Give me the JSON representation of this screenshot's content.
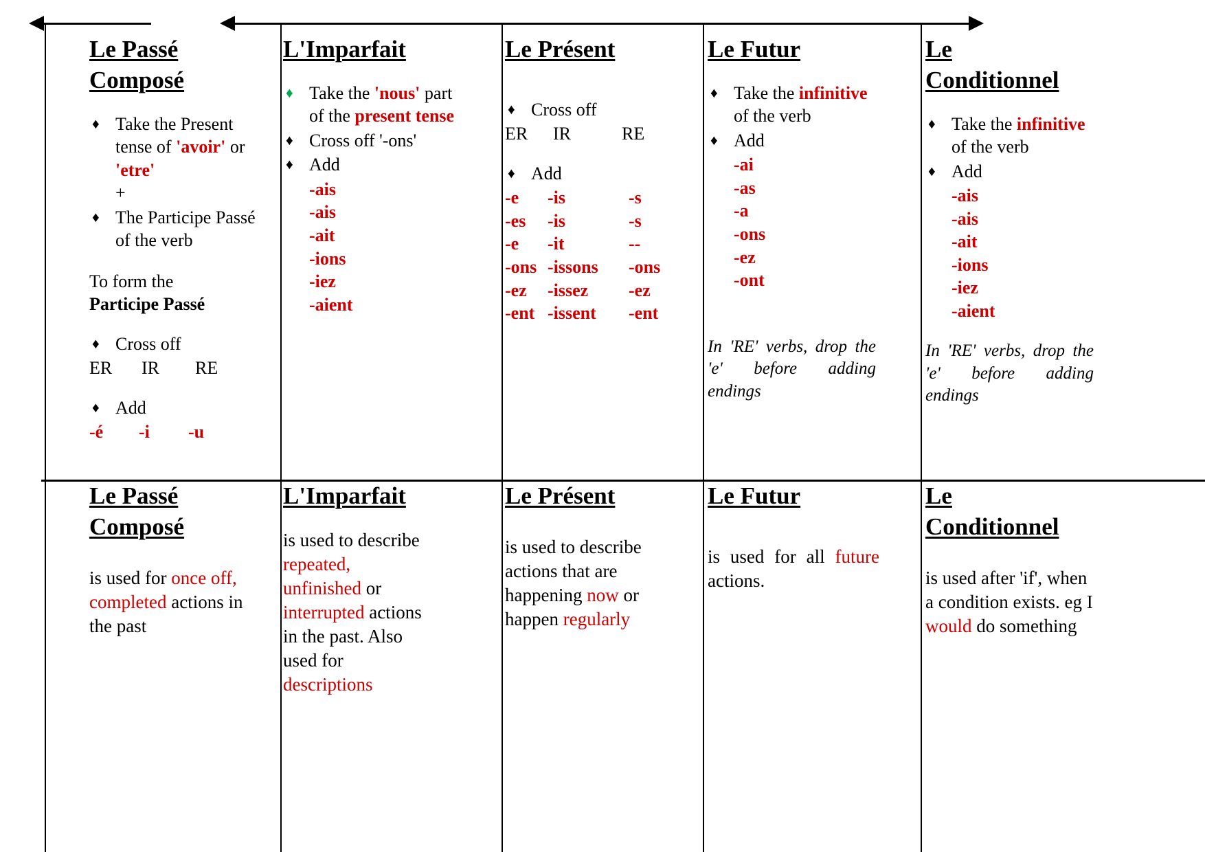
{
  "document": {
    "title": "French Verb Tenses Reference Chart",
    "accent_red": "#cc0000",
    "accent_green": "#00a651"
  },
  "bullet_glyph": "♦",
  "formation": {
    "passe_compose": {
      "title_line1": "Le Passé",
      "title_line2": "Composé",
      "bullet1": "Take the Present tense of ",
      "bullet1_red1": "'avoir'",
      "bullet1_mid": " or ",
      "bullet1_red2": "'etre'",
      "plus": "+",
      "bullet2": "The Participe Passé of the verb",
      "subhead_line1": "To form the",
      "subhead_line2": "Participe Passé",
      "bullet3": "Cross off",
      "stems": [
        "ER",
        "IR",
        "RE"
      ],
      "bullet4": "Add",
      "endings": [
        "-é",
        "-i",
        "-u"
      ]
    },
    "imparfait": {
      "title_line1": "L'Imparfait",
      "bullet1_pre": "Take the ",
      "bullet1_red1": "'nous'",
      "bullet1_mid": " part of the ",
      "bullet1_red2": "present tense",
      "bullet2": "Cross off '-ons'",
      "bullet3": "Add",
      "endings": [
        "-ais",
        "-ais",
        "-ait",
        "-ions",
        "-iez",
        "-aient"
      ]
    },
    "present": {
      "title_line1": "Le Présent",
      "bullet1": "Cross off",
      "stems": [
        "ER",
        "IR",
        "RE"
      ],
      "bullet2": "Add",
      "endings_er": [
        "-e",
        "-es",
        "-e",
        "-ons",
        "-ez",
        "-ent"
      ],
      "endings_ir": [
        "-is",
        "-is",
        "-it",
        "-issons",
        "-issez",
        "-issent"
      ],
      "endings_re": [
        "-s",
        "-s",
        "--",
        "-ons",
        "-ez",
        "-ent"
      ]
    },
    "futur": {
      "title_line1": "Le Futur",
      "bullet1_pre": "Take the ",
      "bullet1_red": "infinitive",
      "bullet1_post": " of the verb",
      "bullet2": "Add",
      "endings": [
        "-ai",
        "-as",
        "-a",
        "-ons",
        "-ez",
        "-ont"
      ],
      "note": "In 'RE' verbs, drop the 'e' before adding endings"
    },
    "conditionnel": {
      "title_line1": "Le",
      "title_line2": "Conditionnel",
      "bullet1_pre": "Take the ",
      "bullet1_red": "infinitive",
      "bullet1_post": " of the verb",
      "bullet2": "Add",
      "endings": [
        "-ais",
        "-ais",
        "-ait",
        "-ions",
        "-iez",
        "-aient"
      ],
      "note": "In 'RE' verbs, drop the 'e' before adding endings"
    }
  },
  "usage": {
    "passe_compose": {
      "title_line1": "Le Passé",
      "title_line2": "Composé",
      "text_pre": "is used for ",
      "text_red": "once off, completed",
      "text_post": " actions in the past"
    },
    "imparfait": {
      "title_line1": "L'Imparfait",
      "text_pre": "is used to describe ",
      "text_red1": "repeated, unfinished",
      "text_mid": " or ",
      "text_red2": "interrupted",
      "text_post": " actions in the past. Also used for ",
      "text_red3": "descriptions"
    },
    "present": {
      "title_line1": "Le Présent",
      "text_pre": "is used to describe actions that are happening ",
      "text_red1": "now",
      "text_mid": " or happen ",
      "text_red2": "regularly"
    },
    "futur": {
      "title_line1": "Le Futur",
      "text_pre": "is used for all ",
      "text_red": "future",
      "text_post": " actions."
    },
    "conditionnel": {
      "title_line1": "Le",
      "title_line2": "Conditionnel",
      "text_pre": "is used after 'if', when a condition exists. eg I ",
      "text_red": "would",
      "text_post": " do something"
    }
  }
}
